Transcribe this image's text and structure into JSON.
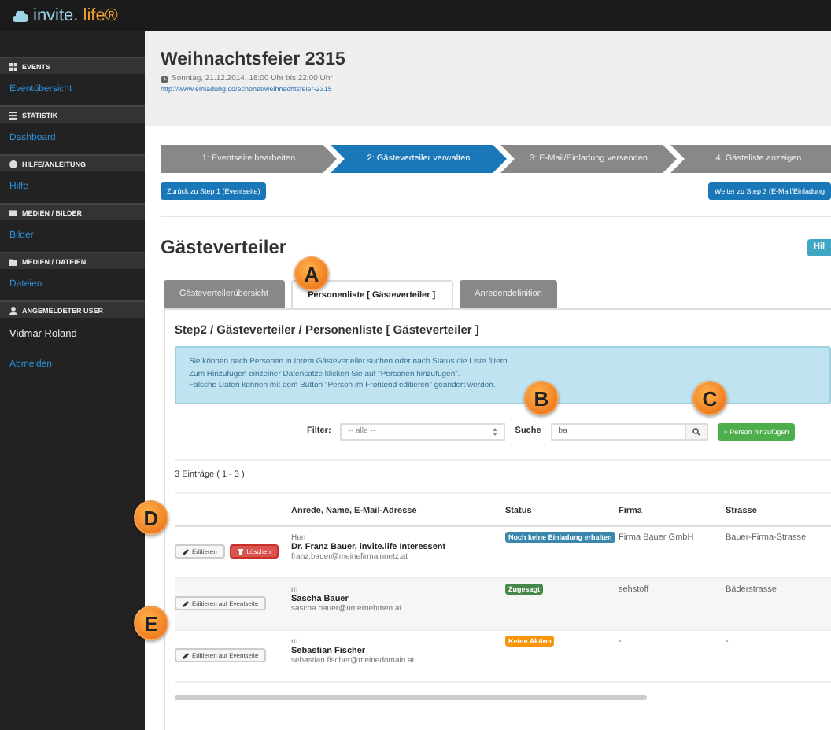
{
  "logo": {
    "text": "invite.",
    "accent": "life®"
  },
  "sidebar": {
    "sections": [
      {
        "title": "EVENTS",
        "items": [
          {
            "kind": "link",
            "label": "Eventübersicht"
          }
        ]
      },
      {
        "title": "STATISTIK",
        "items": [
          {
            "kind": "link",
            "label": "Dashboard"
          }
        ]
      },
      {
        "title": "HILFE/ANLEITUNG",
        "items": [
          {
            "kind": "link",
            "label": "Hilfe"
          }
        ]
      },
      {
        "title": "MEDIEN / BILDER",
        "items": [
          {
            "kind": "link",
            "label": "Bilder"
          }
        ]
      },
      {
        "title": "MEDIEN / DATEIEN",
        "items": [
          {
            "kind": "link",
            "label": "Dateien"
          }
        ]
      },
      {
        "title": "ANGEMELDETER USER",
        "items": [
          {
            "kind": "text",
            "label": "Vidmar Roland"
          },
          {
            "kind": "link",
            "label": "Abmelden"
          }
        ]
      }
    ]
  },
  "event": {
    "title": "Weihnachtsfeier 2315",
    "date": "Sonntag, 21.12.2014, 18:00 Uhr bis 22:00 Uhr",
    "url": "http://www.einladung.co/echonet/weihnachtsfeier-2315"
  },
  "steps": [
    {
      "label": "1: Eventseite bearbeiten",
      "selected": false
    },
    {
      "label": "2: Gästeverteiler verwalten",
      "selected": true
    },
    {
      "label": "3: E-Mail/Einladung versenden",
      "selected": false
    },
    {
      "label": "4: Gästeliste anzeigen",
      "selected": false
    }
  ],
  "back_button": "Zurück zu Step 1 (Eventseite)",
  "next_button": "Weiter zu Step 3 (E-Mail/Einladung",
  "section_title": "Gästeverteiler",
  "help_button": "Hil",
  "tabs": [
    {
      "label": "Gästeverteilerübersicht",
      "selected": false
    },
    {
      "label": "Personenliste [ Gästeverteiler ]",
      "selected": true
    },
    {
      "label": "Anredendefinition",
      "selected": false
    }
  ],
  "panel_title": "Step2 / Gästeverteiler / Personenliste [ Gästeverteiler ]",
  "info": [
    "Sie können nach Personen in Ihrem Gästeverteiler suchen oder nach Status die Liste filtern.",
    "Zum Hinzufügen einzelner Datensätze klicken Sie auf \"Personen hinzufügen\".",
    "Falsche Daten können mit dem Button \"Person im Frontend editieren\" geändert werden."
  ],
  "filter": {
    "label": "Filter:",
    "value": "-- alle --"
  },
  "search": {
    "label": "Suche",
    "value": "ba"
  },
  "add_button": "+ Person hinzufügen",
  "count": "3 Einträge ( 1 - 3 )",
  "table": {
    "columns": [
      "Anrede, Name, E-Mail-Adresse",
      "Status",
      "Firma",
      "Strasse"
    ],
    "rows": [
      {
        "actions": [
          {
            "kind": "edit",
            "label": "Editieren"
          },
          {
            "kind": "delete",
            "label": "Löschen"
          }
        ],
        "salutation": "Herr",
        "name": "Dr. Franz Bauer, invite.life Interessent",
        "email": "franz.bauer@meinefirmainnetz.at",
        "status": {
          "label": "Noch keine Einladung erhalten",
          "color": "#3a87ad"
        },
        "firma": "Firma Bauer GmbH",
        "strasse": "Bauer-Firma-Strasse"
      },
      {
        "actions": [
          {
            "kind": "edit",
            "label": "Editieren auf Eventseite"
          }
        ],
        "salutation": "m",
        "name": "Sascha Bauer",
        "email": "sascha.bauer@unternehmen.at",
        "status": {
          "label": "Zugesagt",
          "color": "#468847"
        },
        "firma": "sehstoff",
        "strasse": "Bäderstrasse"
      },
      {
        "actions": [
          {
            "kind": "edit",
            "label": "Editieren auf Eventseite"
          }
        ],
        "salutation": "m",
        "name": "Sebastian Fischer",
        "email": "sebastian.fischer@meinedomain.at",
        "status": {
          "label": "Keine Aktion",
          "color": "#f89406"
        },
        "firma": "-",
        "strasse": "-"
      }
    ]
  },
  "callouts": [
    "A",
    "B",
    "C",
    "D",
    "E"
  ]
}
